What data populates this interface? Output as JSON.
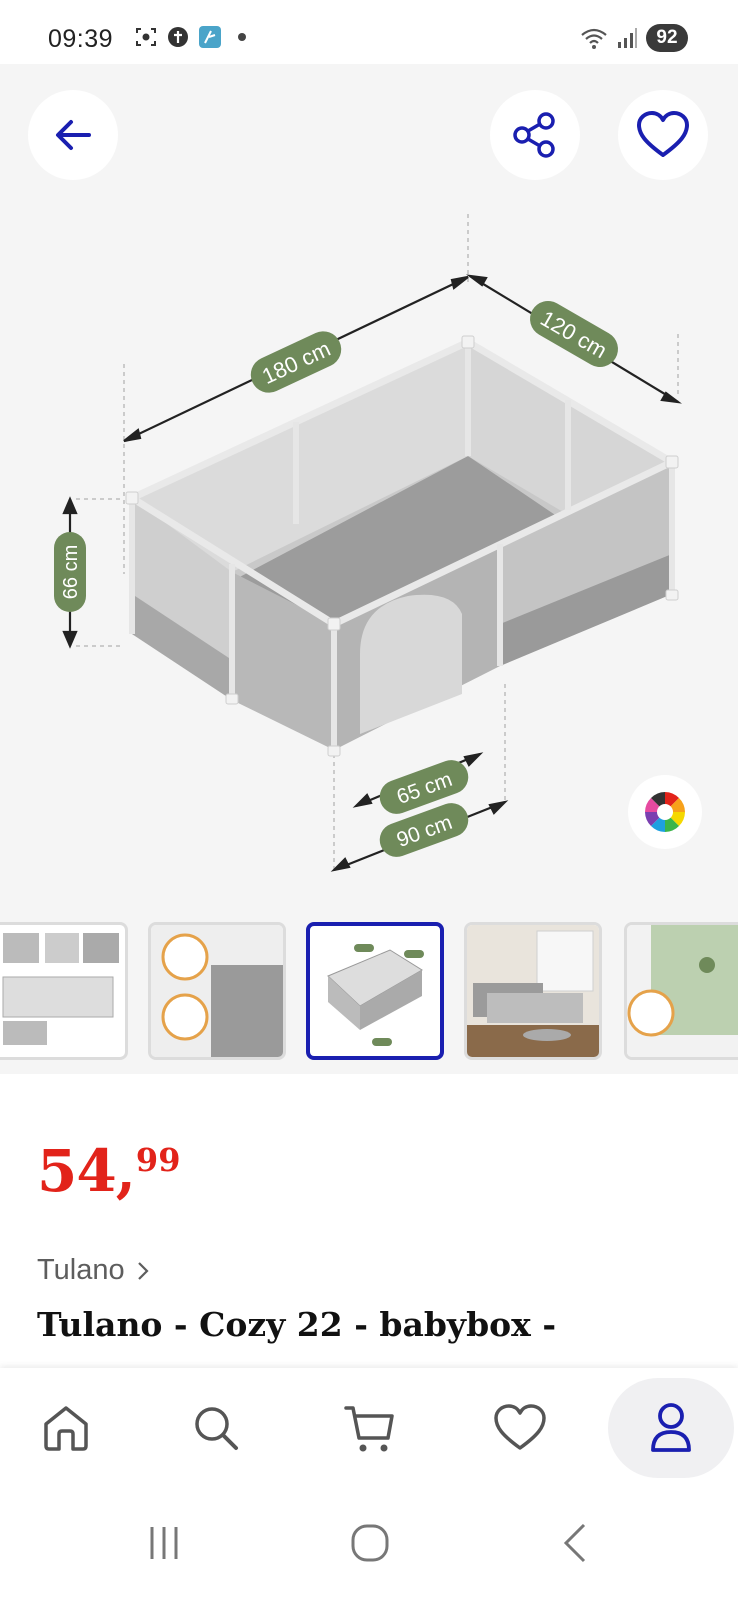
{
  "status_bar": {
    "time": "09:39",
    "left_icons": [
      "screenshot-icon",
      "vpn-icon",
      "app-notification-icon"
    ],
    "right_icons": [
      "wifi-icon",
      "signal-icon"
    ],
    "battery": "92"
  },
  "hero": {
    "back_icon": "arrow-left-icon",
    "share_icon": "share-icon",
    "favorite_icon": "heart-icon",
    "color_options_icon": "color-wheel-icon",
    "dimensions": {
      "length": "180 cm",
      "width": "120 cm",
      "height": "66 cm",
      "door_inner": "65 cm",
      "door_outer": "90 cm"
    }
  },
  "thumbnails": [
    {
      "name": "thumb-1",
      "selected": false
    },
    {
      "name": "thumb-2",
      "selected": false
    },
    {
      "name": "thumb-3",
      "selected": true
    },
    {
      "name": "thumb-4",
      "selected": false
    },
    {
      "name": "thumb-5",
      "selected": false
    }
  ],
  "product": {
    "price_int": "54",
    "price_sep": ",",
    "price_dec": "99",
    "brand": "Tulano",
    "title": "Tulano - Cozy 22 - babybox -"
  },
  "bottom_nav": [
    {
      "name": "home",
      "icon": "home-icon"
    },
    {
      "name": "search",
      "icon": "search-icon"
    },
    {
      "name": "cart",
      "icon": "cart-icon"
    },
    {
      "name": "favorites",
      "icon": "heart-icon"
    },
    {
      "name": "account",
      "icon": "user-icon",
      "active": true
    }
  ],
  "colors": {
    "accent": "#1a1fb0",
    "price": "#e2231a",
    "dimension_label": "#6f8a5a"
  }
}
